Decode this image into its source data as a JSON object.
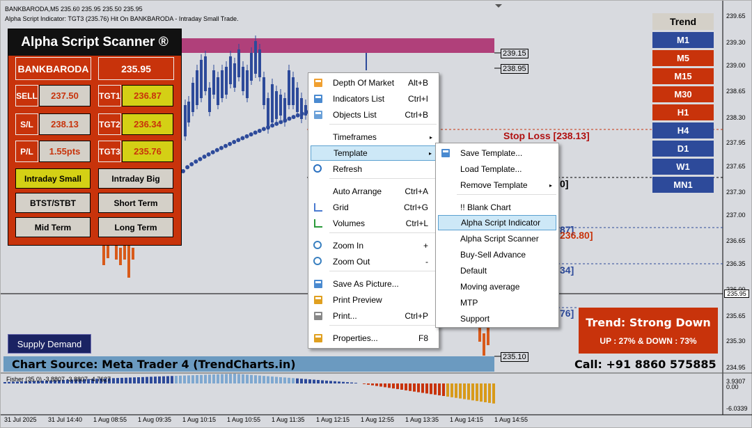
{
  "header": {
    "symbol_line": "BANKBARODA,M5  235.60 235.95 235.50 235.95",
    "indicator_line": "Alpha Script Indicator: TGT3 (235.76) Hit On BANKBARODA - Intraday Small Trade."
  },
  "price_axis": [
    "239.65",
    "239.30",
    "239.00",
    "238.65",
    "238.30",
    "237.95",
    "237.65",
    "237.30",
    "237.00",
    "236.65",
    "236.35",
    "236.00",
    "235.95",
    "235.65",
    "235.30",
    "234.95"
  ],
  "fisher_axis": [
    "3.9307",
    "0.00",
    "-6.0339"
  ],
  "time_axis": [
    "31 Jul 2025",
    "31 Jul 14:40",
    "1 Aug 08:55",
    "1 Aug 09:35",
    "1 Aug 10:15",
    "1 Aug 10:55",
    "1 Aug 11:35",
    "1 Aug 12:15",
    "1 Aug 12:55",
    "1 Aug 13:35",
    "1 Aug 14:15",
    "1 Aug 14:55"
  ],
  "box_labels": {
    "a": "239.15",
    "b": "238.95",
    "c": "235.10"
  },
  "chart_text": {
    "stop_loss": "Stop Loss [238.13]",
    "partial_0": "0]",
    "partial_87": "87]",
    "tgt_red": "236.80]",
    "partial_34": "34]",
    "partial_76": "76]"
  },
  "scanner": {
    "title": "Alpha Script Scanner ®",
    "symbol": "BANKBARODA",
    "price": "235.95",
    "rows": [
      {
        "label": "SELL",
        "value": "237.50",
        "tlabel": "TGT1",
        "tvalue": "236.87"
      },
      {
        "label": "S/L",
        "value": "238.13",
        "tlabel": "TGT2",
        "tvalue": "236.34"
      },
      {
        "label": "P/L",
        "value": "1.55pts",
        "tlabel": "TGT3",
        "tvalue": "235.76"
      }
    ],
    "buttons": [
      "Intraday Small",
      "Intraday Big",
      "BTST/STBT",
      "Short Term",
      "Mid Term",
      "Long Term"
    ]
  },
  "trend": {
    "title": "Trend",
    "timeframes": [
      {
        "label": "M1",
        "color": "#2d4a9a"
      },
      {
        "label": "M5",
        "color": "#c8330b"
      },
      {
        "label": "M15",
        "color": "#c8330b"
      },
      {
        "label": "M30",
        "color": "#c8330b"
      },
      {
        "label": "H1",
        "color": "#c8330b"
      },
      {
        "label": "H4",
        "color": "#2d4a9a"
      },
      {
        "label": "D1",
        "color": "#2d4a9a"
      },
      {
        "label": "W1",
        "color": "#2d4a9a"
      },
      {
        "label": "MN1",
        "color": "#2d4a9a"
      }
    ]
  },
  "context_menu": [
    {
      "label": "Depth Of Market",
      "shortcut": "Alt+B",
      "icon": "depth-icon"
    },
    {
      "label": "Indicators List",
      "shortcut": "Ctrl+I",
      "icon": "indicators-icon"
    },
    {
      "label": "Objects List",
      "shortcut": "Ctrl+B",
      "icon": "objects-icon"
    },
    {
      "label": "Timeframes",
      "shortcut": "",
      "icon": ""
    },
    {
      "label": "Template",
      "shortcut": "",
      "icon": ""
    },
    {
      "label": "Refresh",
      "shortcut": "",
      "icon": "refresh-icon"
    },
    {
      "label": "Auto Arrange",
      "shortcut": "Ctrl+A",
      "icon": ""
    },
    {
      "label": "Grid",
      "shortcut": "Ctrl+G",
      "icon": "grid-icon"
    },
    {
      "label": "Volumes",
      "shortcut": "Ctrl+L",
      "icon": "volumes-icon"
    },
    {
      "label": "Zoom In",
      "shortcut": "+",
      "icon": "zoom-in-icon"
    },
    {
      "label": "Zoom Out",
      "shortcut": "-",
      "icon": "zoom-out-icon"
    },
    {
      "label": "Save As Picture...",
      "shortcut": "",
      "icon": "picture-icon"
    },
    {
      "label": "Print Preview",
      "shortcut": "",
      "icon": "print-preview-icon"
    },
    {
      "label": "Print...",
      "shortcut": "Ctrl+P",
      "icon": "print-icon"
    },
    {
      "label": "Properties...",
      "shortcut": "F8",
      "icon": "properties-icon"
    }
  ],
  "template_menu": [
    {
      "label": "Save Template...",
      "icon": "save-template-icon"
    },
    {
      "label": "Load Template..."
    },
    {
      "label": "Remove Template"
    },
    {
      "label": "!! Blank Chart"
    },
    {
      "label": "Alpha Script Indicator"
    },
    {
      "label": "Alpha Script Scanner"
    },
    {
      "label": "Buy-Sell Advance"
    },
    {
      "label": "Default"
    },
    {
      "label": "Moving average"
    },
    {
      "label": "MTP"
    },
    {
      "label": "Support"
    }
  ],
  "bottom": {
    "supply_demand": "Supply Demand",
    "trend_strong": "Trend: Strong Down",
    "up_down": "UP : 27% & DOWN : 73%",
    "chart_source": "Chart Source: Meta Trader 4 (TrendCharts.in)",
    "call": "Call: +91 8860 575885",
    "fisher": "Fisher (35,0) -3.8807 -3.8807 -4.7627",
    "current_price": "235.95"
  },
  "colors": {
    "sell_red": "#c8330b",
    "buy_blue": "#2d4a9a",
    "zone_pink": "#b0407a",
    "bg": "#d8dadf"
  }
}
